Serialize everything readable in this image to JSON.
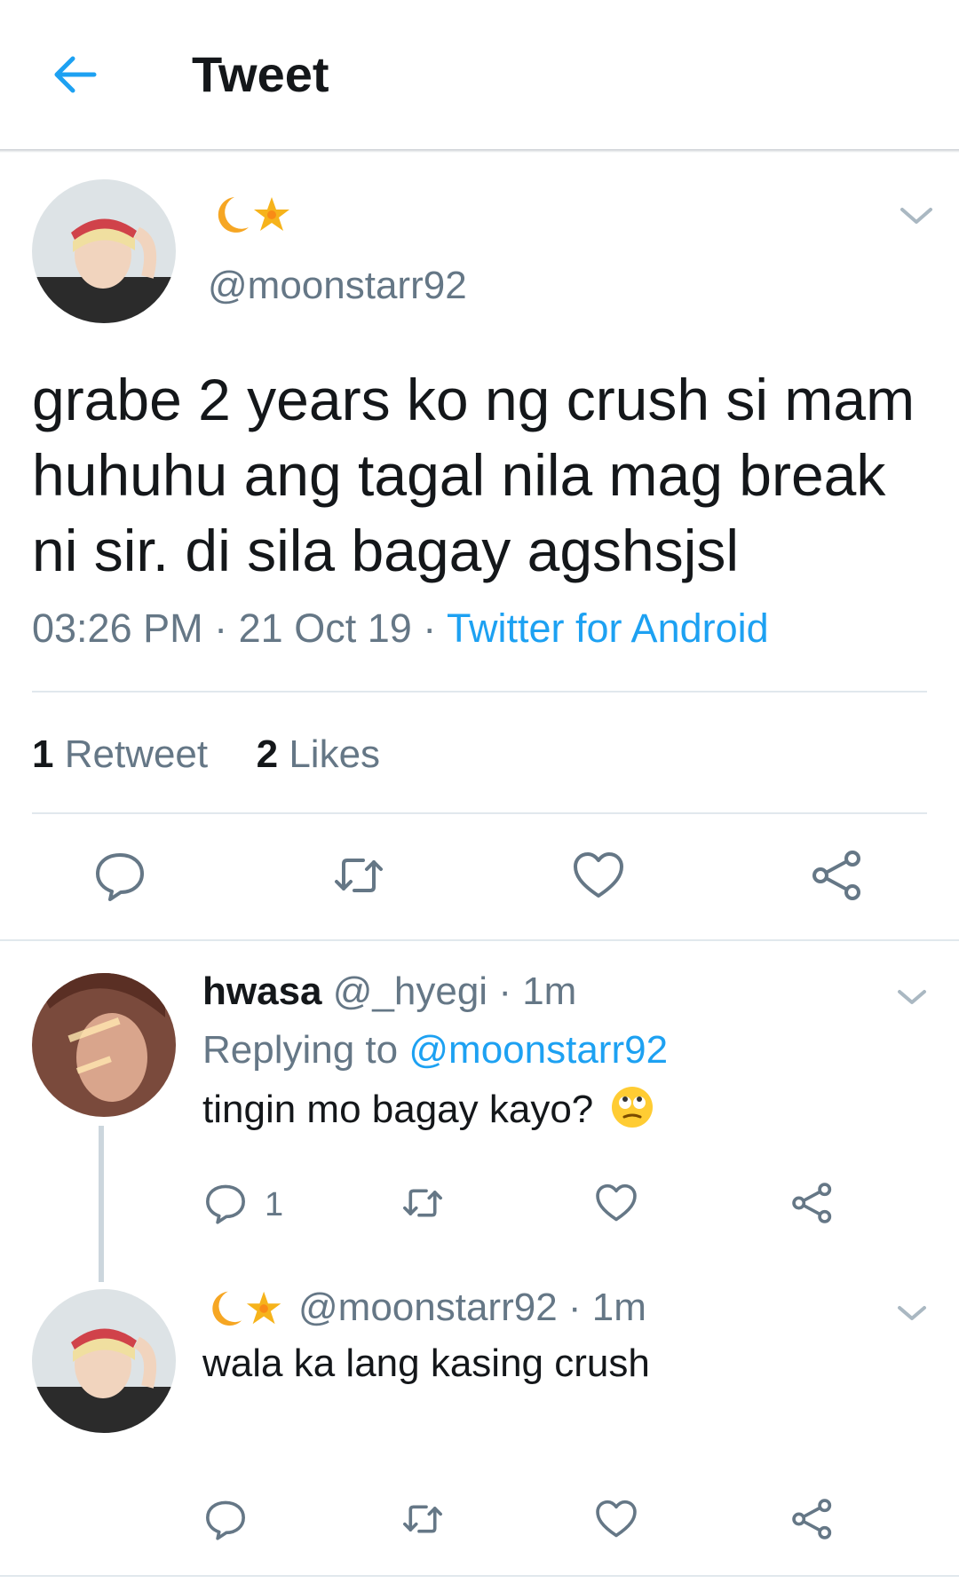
{
  "header": {
    "title": "Tweet"
  },
  "main_tweet": {
    "handle": "@moonstarr92",
    "text": "grabe 2 years ko ng crush si mam huhuhu ang tagal nila mag break ni sir. di sila bagay agshsjsl",
    "time": "03:26 PM",
    "separator": "·",
    "date": "21 Oct 19",
    "source": "Twitter for Android",
    "retweet_count": "1",
    "retweet_label": "Retweet",
    "like_count": "2",
    "like_label": "Likes"
  },
  "replies": [
    {
      "name": "hwasa",
      "handle": "@_hyegi",
      "separator": "·",
      "time": "1m",
      "replying_prefix": "Replying to",
      "replying_handle": "@moonstarr92",
      "text": "tingin mo bagay kayo?",
      "reply_count": "1"
    },
    {
      "handle": "@moonstarr92",
      "separator": "·",
      "time": "1m",
      "text": "wala ka lang kasing crush"
    }
  ],
  "colors": {
    "accent": "#1da1f2",
    "muted": "#657786",
    "text": "#14171a",
    "divider": "#e1e8ed"
  },
  "icons": [
    "back-arrow-icon",
    "moon-icon",
    "sparkle-star-icon",
    "chevron-down-icon",
    "reply-icon",
    "retweet-icon",
    "like-heart-icon",
    "share-icon",
    "rolling-eyes-emoji-icon"
  ]
}
